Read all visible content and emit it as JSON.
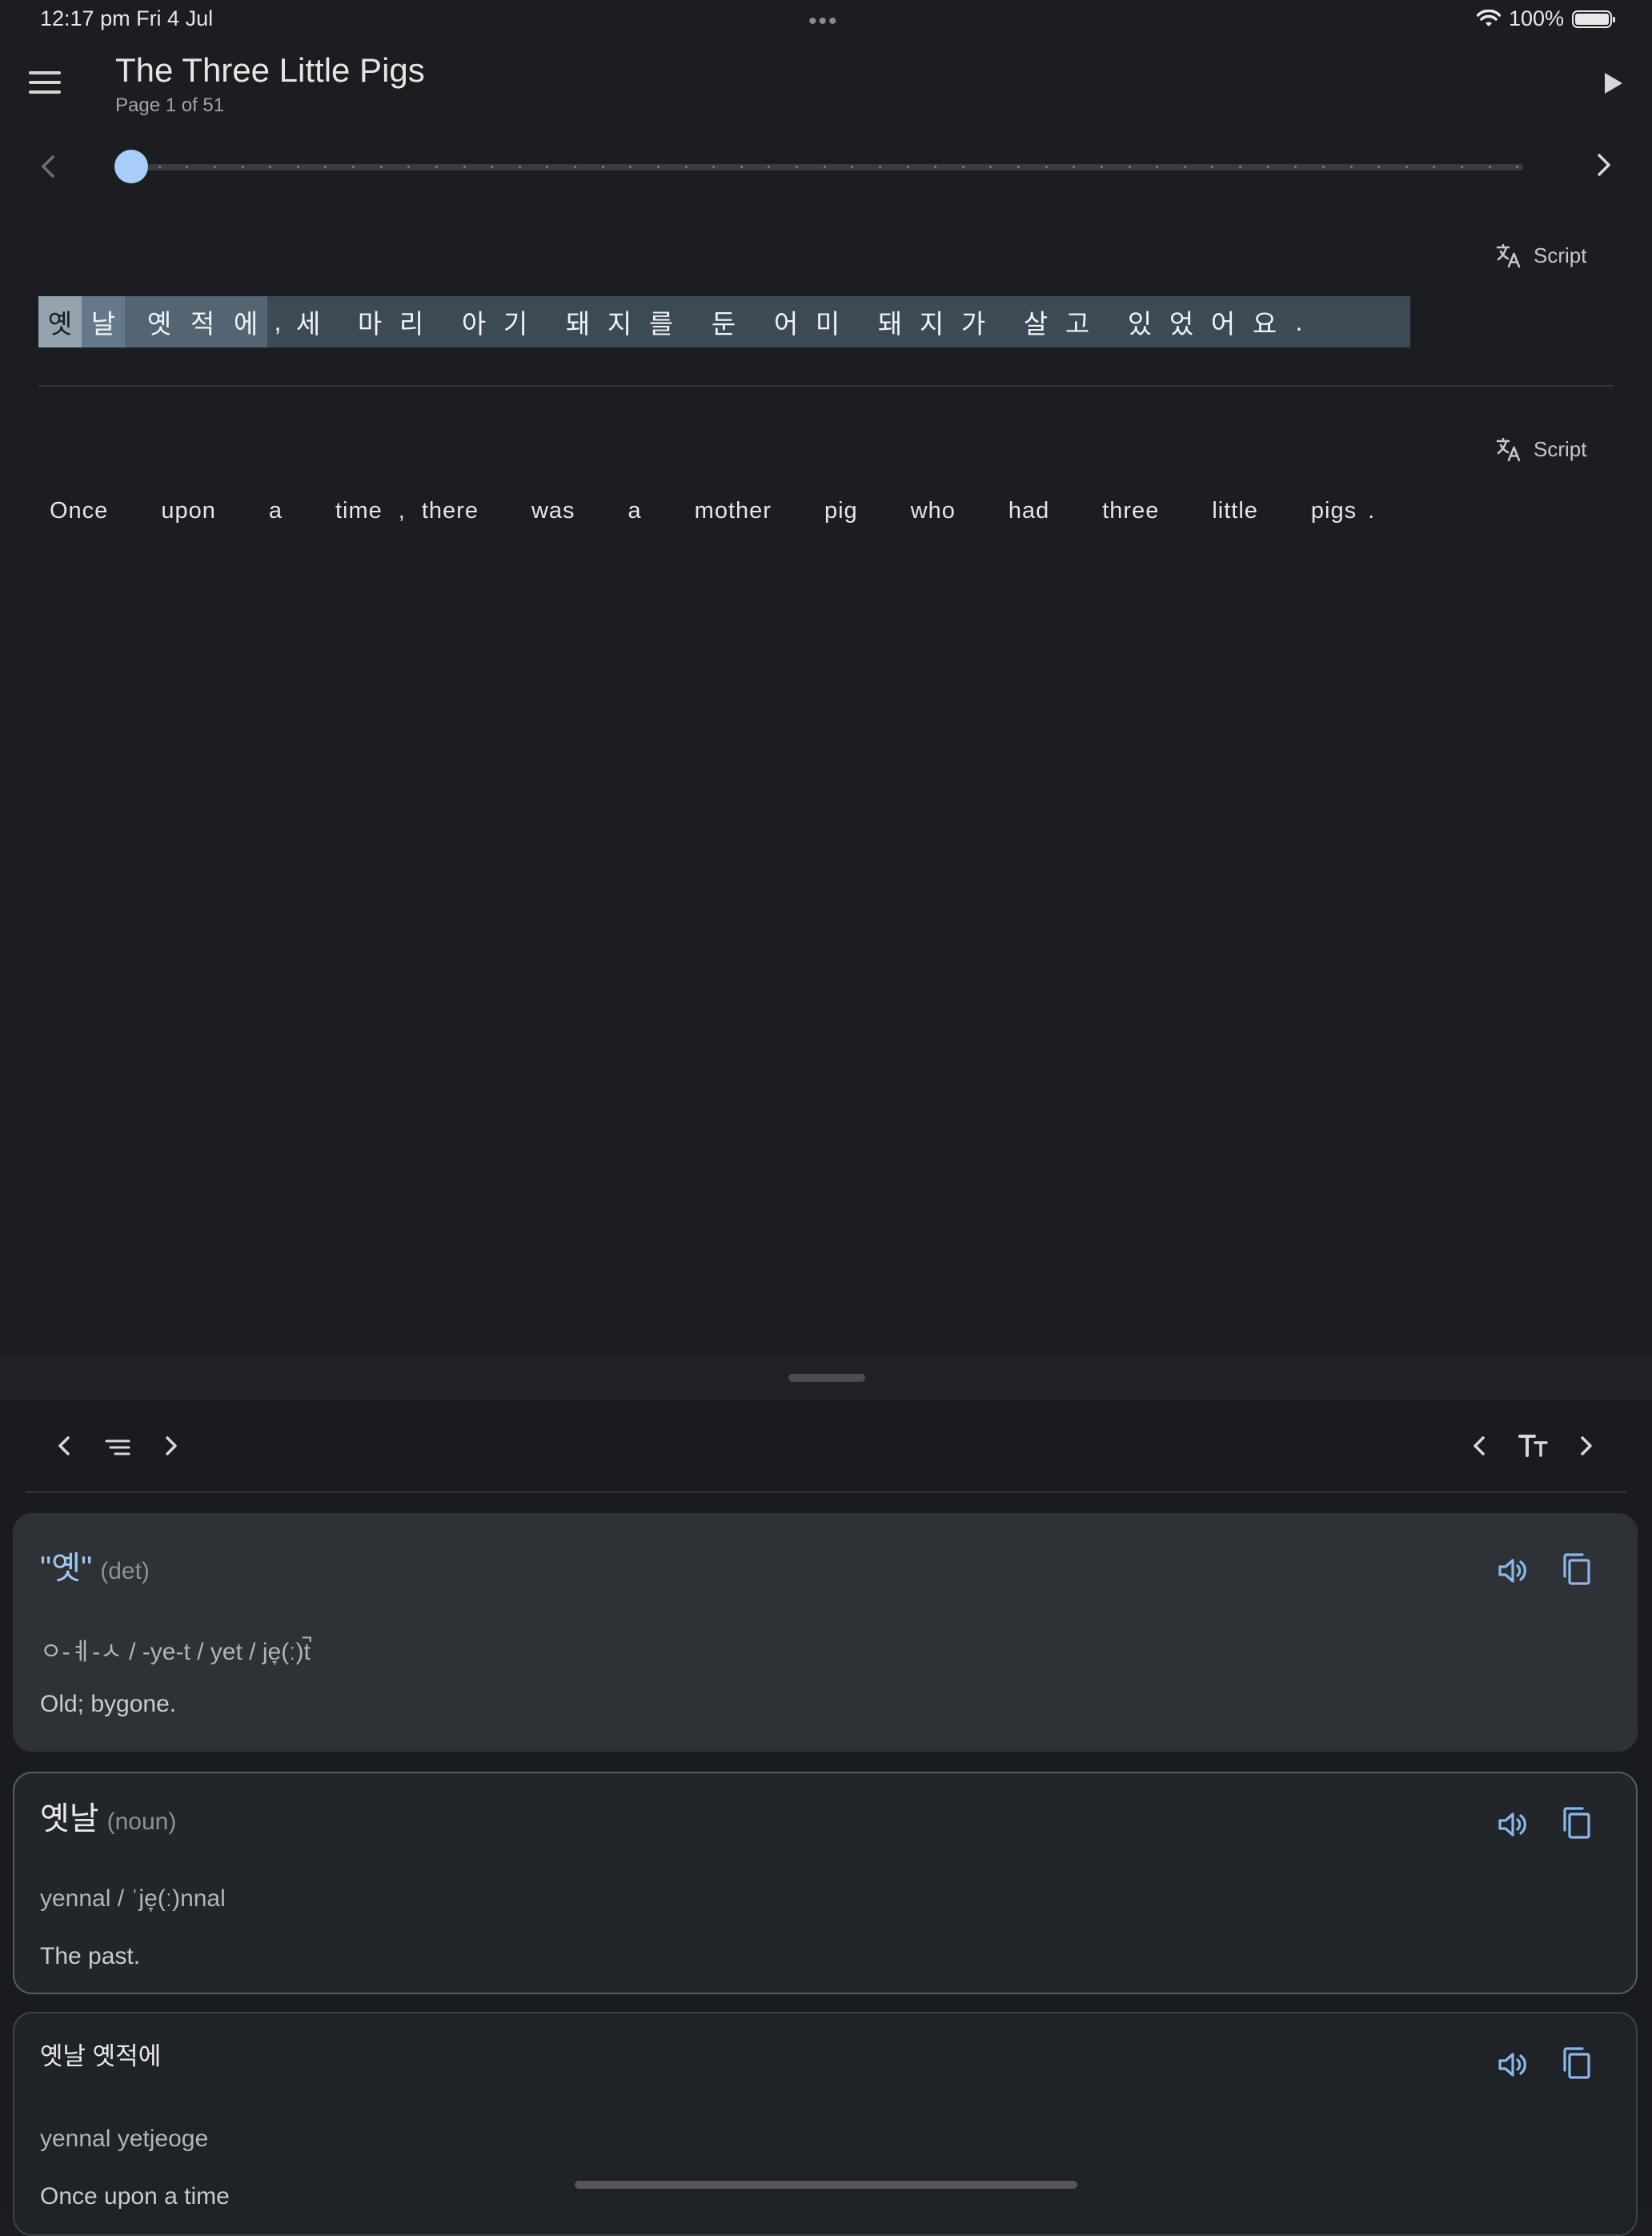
{
  "status_bar": {
    "time": "12:17 pm   Fri 4 Jul",
    "dots": "•••",
    "battery_pct": "100%"
  },
  "header": {
    "title": "The Three Little Pigs",
    "subtitle": "Page 1 of 51"
  },
  "slider": {
    "current_page": 1,
    "total_pages": 51
  },
  "script_button_label": "Script",
  "korean_tokens": [
    "옛",
    "날",
    "옛",
    "적",
    "에",
    ",",
    "세",
    "마",
    "리",
    "아",
    "기",
    "돼",
    "지",
    "를",
    "둔",
    "어",
    "미",
    "돼",
    "지",
    "가",
    "살",
    "고",
    "있",
    "었",
    "어",
    "요",
    "."
  ],
  "english_tokens": [
    "Once",
    "upon",
    "a",
    "time",
    ",",
    "there",
    "was",
    "a",
    "mother",
    "pig",
    "who",
    "had",
    "three",
    "little",
    "pigs",
    "."
  ],
  "cards": [
    {
      "headword": "\"옛\"",
      "pos": "(det)",
      "romanization": "ㅇ-ㅖ-ㅅ / -ye-t / yet / je̞(ː)t̚",
      "definition": "Old; bygone."
    },
    {
      "headword": "옛날",
      "pos": "(noun)",
      "romanization": "yennal / ˈje̞(ː)nnal",
      "definition": "The past."
    },
    {
      "headword": "옛날 옛적에",
      "pos": "",
      "romanization": "yennal yetjeoge",
      "definition": "Once upon a time"
    }
  ],
  "colors": {
    "accent": "#a7cdfb",
    "background": "#1c1d20",
    "highlight": "#3b4a54"
  }
}
